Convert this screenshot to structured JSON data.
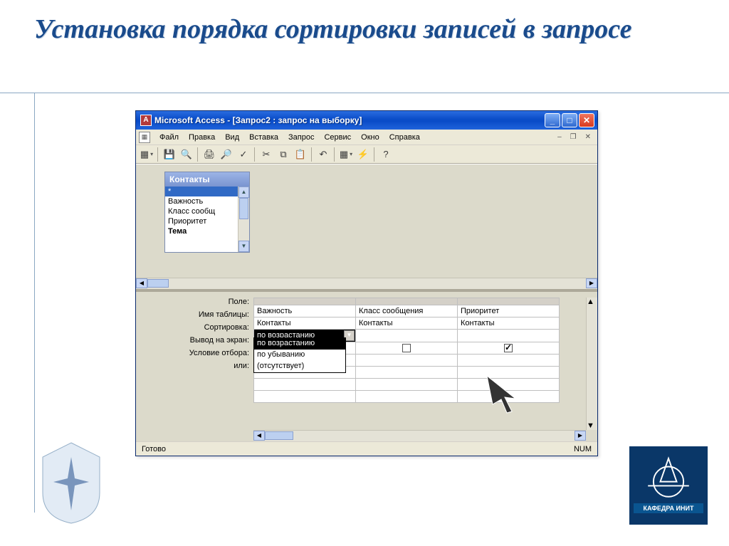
{
  "slide": {
    "title": "Установка порядка сортировки записей в запросе"
  },
  "window": {
    "title": "Microsoft Access - [Запрос2 : запрос на выборку]",
    "menu": [
      "Файл",
      "Правка",
      "Вид",
      "Вставка",
      "Запрос",
      "Сервис",
      "Окно",
      "Справка"
    ],
    "status_left": "Готово",
    "status_right": "NUM"
  },
  "tablebox": {
    "title": "Контакты",
    "fields": [
      "*",
      "Важность",
      "Класс сообщ",
      "Приоритет",
      "Тема"
    ]
  },
  "grid": {
    "labels": [
      "Поле:",
      "Имя таблицы:",
      "Сортировка:",
      "Вывод на экран:",
      "Условие отбора:",
      "или:"
    ],
    "cols": [
      {
        "field": "Важность",
        "table": "Контакты",
        "sort": "по возрастанию",
        "show": true
      },
      {
        "field": "Класс сообщения",
        "table": "Контакты",
        "sort": "",
        "show": false
      },
      {
        "field": "Приоритет",
        "table": "Контакты",
        "sort": "",
        "show": true
      }
    ],
    "sort_dropdown": [
      "по возрастанию",
      "по убыванию",
      "(отсутствует)"
    ],
    "sort_highlight": "по возрастанию"
  },
  "logo_right": {
    "label": "КАФЕДРА ИНИТ"
  }
}
